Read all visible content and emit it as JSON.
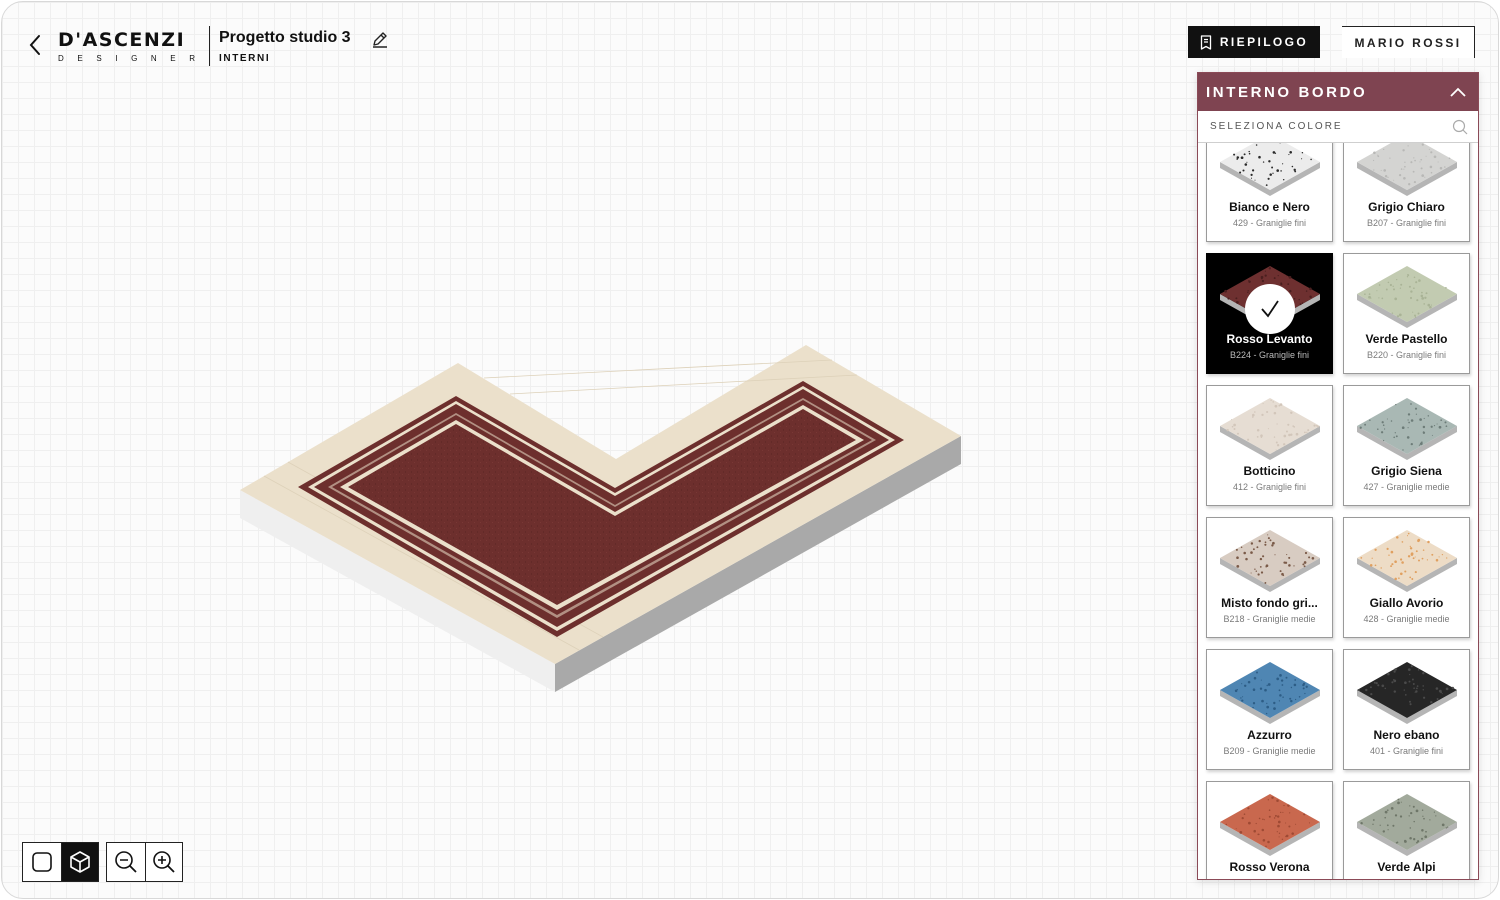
{
  "header": {
    "brand": "D'ASCENZI",
    "brand_sub": "DESIGNER",
    "project_name": "Progetto studio 3",
    "project_section": "INTERNI",
    "summary_label": "RIEPILOGO",
    "user_name": "MARIO ROSSI"
  },
  "icons": {
    "back": "chevron-left-icon",
    "edit": "pencil-icon",
    "summary": "receipt-icon",
    "collapse": "chevron-up-icon",
    "search": "search-icon",
    "view_2d": "square-icon",
    "view_3d": "cube-icon",
    "zoom_out": "zoom-out-icon",
    "zoom_in": "zoom-in-icon",
    "selected": "check-icon"
  },
  "panel": {
    "title": "INTERNO BORDO",
    "search_placeholder": "SELEZIONA COLORE",
    "accent_color": "#7f4451",
    "selected_item": "Rosso Levanto",
    "items": [
      {
        "name": "Bianco e Nero",
        "code": "429 - Graniglie fini",
        "color": "#ececec",
        "speckle": "#2a2a2a",
        "selected": false
      },
      {
        "name": "Grigio Chiaro",
        "code": "B207 - Graniglie fini",
        "color": "#d4d4d2",
        "speckle": "#b8b8b6",
        "selected": false
      },
      {
        "name": "Rosso Levanto",
        "code": "B224 - Graniglie fini",
        "color": "#6e3030",
        "speckle": "#4a1f1f",
        "selected": true
      },
      {
        "name": "Verde Pastello",
        "code": "B220 - Graniglie fini",
        "color": "#c2cbb1",
        "speckle": "#a9b396",
        "selected": false
      },
      {
        "name": "Botticino",
        "code": "412 - Graniglie fini",
        "color": "#e6ddd3",
        "speckle": "#d2c6ba",
        "selected": false
      },
      {
        "name": "Grigio Siena",
        "code": "427 - Graniglie medie",
        "color": "#a9b8b4",
        "speckle": "#6d7c78",
        "selected": false
      },
      {
        "name": "Misto fondo gri...",
        "code": "B218 - Graniglie medie",
        "color": "#d8ccc2",
        "speckle": "#7a5a48",
        "selected": false
      },
      {
        "name": "Giallo Avorio",
        "code": "428 - Graniglie medie",
        "color": "#eddcc6",
        "speckle": "#e0a060",
        "selected": false
      },
      {
        "name": "Azzurro",
        "code": "B209 - Graniglie medie",
        "color": "#4f86b3",
        "speckle": "#2d5d86",
        "selected": false
      },
      {
        "name": "Nero ebano",
        "code": "401 - Graniglie fini",
        "color": "#262626",
        "speckle": "#4a4a4a",
        "selected": false
      },
      {
        "name": "Rosso Verona",
        "code": "",
        "color": "#c9684e",
        "speckle": "#9e4a34",
        "selected": false
      },
      {
        "name": "Verde Alpi",
        "code": "",
        "color": "#a2aa9c",
        "speckle": "#6e7668",
        "selected": false
      }
    ]
  },
  "floor": {
    "surface_color": "#ebe0cb",
    "field_color": "#6d2f2d",
    "side_left_color": "#efefef",
    "side_right_color": "#a7a7a7"
  }
}
